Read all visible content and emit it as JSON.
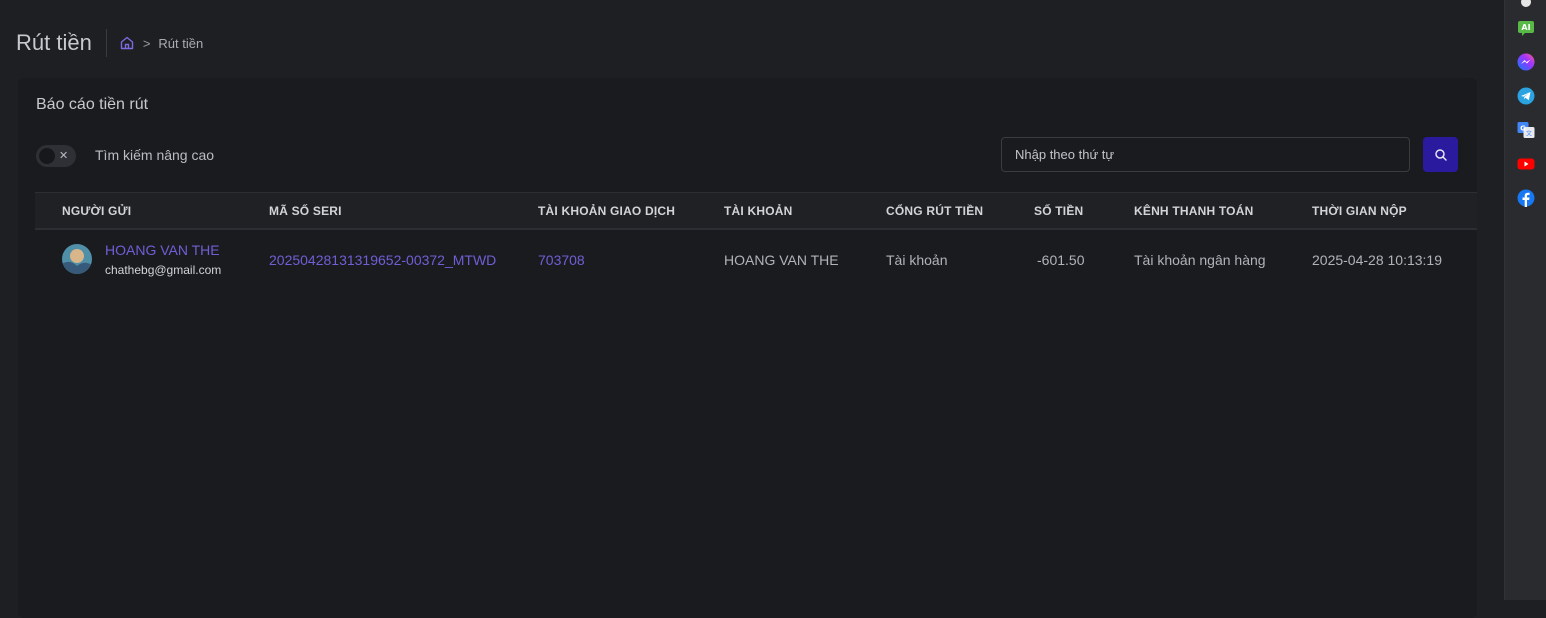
{
  "header": {
    "title": "Rút tiền",
    "breadcrumb_current": "Rút tiền",
    "breadcrumb_separator": ">"
  },
  "card": {
    "title": "Báo cáo tiền rút",
    "advanced_search_label": "Tìm kiếm nâng cao",
    "toggle_mark": "✕",
    "search_placeholder": "Nhập theo thứ tự"
  },
  "table": {
    "columns": [
      "NGƯỜI GỬI",
      "MÃ SỐ SERI",
      "TÀI KHOẢN GIAO DỊCH",
      "TÀI KHOẢN",
      "CỔNG RÚT TIỀN",
      "SỐ TIỀN",
      "KÊNH THANH TOÁN",
      "THỜI GIAN NỘP"
    ],
    "rows": [
      {
        "sender_name": "HOANG VAN THE",
        "sender_email": "chathebg@gmail.com",
        "serial": "20250428131319652-00372_MTWD",
        "trading_account": "703708",
        "account": "HOANG VAN THE",
        "gateway": "Tài khoản",
        "amount": "-601.50",
        "channel": "Tài khoản ngân hàng",
        "submitted_at": "2025-04-28 10:13:19"
      }
    ]
  },
  "sidebar_icons": [
    "ai-icon",
    "messenger-icon",
    "telegram-icon",
    "google-translate-icon",
    "youtube-icon",
    "facebook-icon"
  ],
  "colors": {
    "accent": "#6f5fd6",
    "search_button": "#2a1a9e",
    "background": "#1e1f22",
    "card": "#1a1b1e"
  }
}
